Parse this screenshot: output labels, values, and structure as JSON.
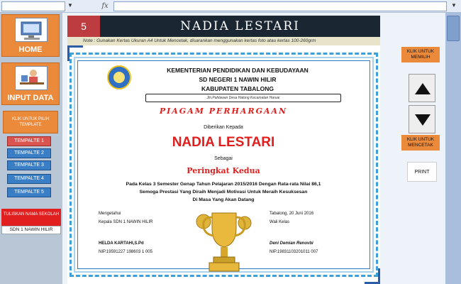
{
  "formula_bar": {
    "fx_label": "fx",
    "dropdown_glyph": "▼",
    "expand_glyph": "▼"
  },
  "left_panel": {
    "home_label": "HOME",
    "input_label": "INPUT DATA",
    "pick_template_label": "KLIK UNTUK PILIH TEMPLATE",
    "templates": [
      "TEMPALTE 1",
      "TEMPALTE 2",
      "TEMPALTE 3",
      "TEMPALTE 4",
      "TEMPALTE 5"
    ],
    "active_template": "TEMPALTE 1",
    "school_name_label": "TULISKAN NAMA SEKOLAH",
    "school_name_value": "SDN 1 NAWIN HILIR"
  },
  "header": {
    "number": "5",
    "title": "NADIA LESTARI",
    "note": "Note : Gunakan Kertas Ukuran A4 Untuk Mencetak, disarankan menggunakan kertas foto atau kertas 100-260grm"
  },
  "certificate": {
    "line1": "KEMENTERIAN PENDIDIKAN DAN KEBUDAYAAN",
    "line2": "SD NEGERI 1 NAWIN HILIR",
    "line3": "KABUPATEN TABALONG",
    "address": "Jln.Pahlawan Desa Halong Kecamatan Haruai",
    "heading": "PIAGAM PERHARGAAN",
    "given_to": "Diberikan Kepada",
    "name": "NADIA LESTARI",
    "as": "Sebagai",
    "rank": "Peringkat Kedua",
    "body1": "Pada Kelas 3 Semester Genap Tahun Pelajaran 2015/2016 Dengan Rata-rata Nilai 86,1",
    "body2": "Semoga Prestasi Yang Diraih Menjadi Motivasi Untuk Meraih Kesuksesan",
    "body3": "Di Masa Yang Akan Datang",
    "left_sig_1": "Mengetahui",
    "left_sig_2": "Kepala SDN 1 NAWIN HILIR",
    "left_sig_name": "HELDA KARTAHI,S.Pd",
    "left_sig_nip": "NIP.19591227 198603 1 005",
    "right_sig_1": "Tabalong, 20 Juni 2016",
    "right_sig_2": "Wali Kelas",
    "right_sig_name": "Deni Demian Renovbi",
    "right_sig_nip": "NIP.19831103201011 007"
  },
  "right_panel": {
    "pick_label": "KLIK UNTUK MEMILIH",
    "up_glyph": "▲",
    "down_glyph": "▼",
    "print_label_top": "KLIK UNTUK MENCETAK",
    "print_button": "PRINT"
  },
  "colors": {
    "accent_orange": "#ec8a3c",
    "title_bar": "#1a2733",
    "number_box": "#bd3c3f",
    "cert_red": "#e01e1e",
    "frame_blue": "#3ea0d8"
  }
}
